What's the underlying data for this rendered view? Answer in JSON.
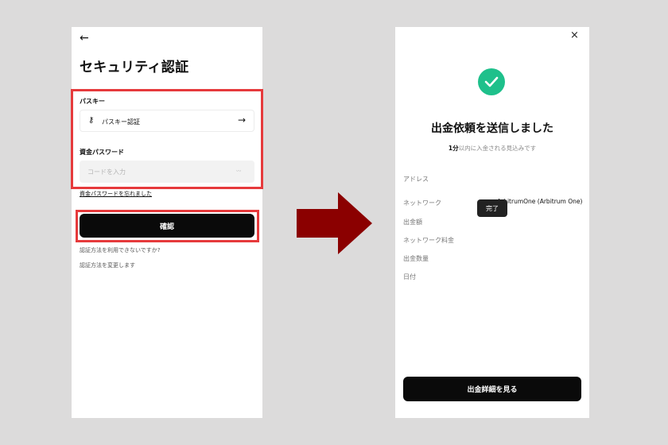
{
  "colors": {
    "background": "#dcdbdb",
    "highlight": "#e63a3c",
    "arrow": "#8b0000",
    "success": "#1ec08b",
    "button": "#0a0a0a"
  },
  "left": {
    "back_icon": "arrow-left-icon",
    "title": "セキュリティ認証",
    "passkey_label": "パスキー",
    "passkey_button_label": "パスキー認証",
    "password_label": "資金パスワード",
    "password_placeholder": "コードを入力",
    "eye_icon_text": "ᵕᵕ",
    "forgot_link": "資金パスワードを忘れました",
    "confirm_button": "確認",
    "unavailable_link": "認証方法を利用できないですか?",
    "change_method_link": "認証方法を変更します"
  },
  "right": {
    "close_icon": "×",
    "title": "出金依頼を送信しました",
    "eta_bold": "1分",
    "eta_rest": "以内に入金される見込みです",
    "rows": [
      "アドレス",
      "ネットワーク",
      "出金額",
      "ネットワーク料金",
      "出金数量",
      "日付"
    ],
    "network_value": "ArbitrumOne (Arbitrum One)",
    "tooltip": "完了",
    "details_button": "出金詳細を見る"
  }
}
